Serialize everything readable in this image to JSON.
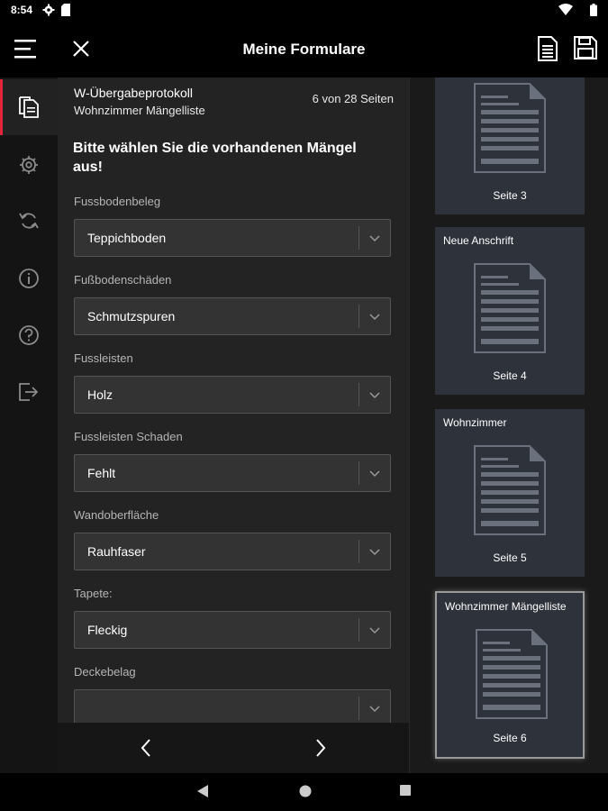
{
  "status_bar": {
    "time": "8:54"
  },
  "app_bar": {
    "title": "Meine Formulare"
  },
  "form": {
    "header_title": "W-Übergabeprotokoll",
    "header_subtitle": "Wohnzimmer Mängelliste",
    "page_indicator": "6 von 28 Seiten",
    "prompt": "Bitte wählen Sie die vorhandenen Mängel aus!",
    "fields": [
      {
        "label": "Fussbodenbeleg",
        "value": "Teppichboden"
      },
      {
        "label": "Fußbodenschäden",
        "value": "Schmutzspuren"
      },
      {
        "label": "Fussleisten",
        "value": "Holz"
      },
      {
        "label": "Fussleisten Schaden",
        "value": "Fehlt"
      },
      {
        "label": "Wandoberfläche",
        "value": "Rauhfaser"
      },
      {
        "label": "Tapete:",
        "value": "Fleckig"
      },
      {
        "label": "Deckebelag",
        "value": ""
      }
    ]
  },
  "thumbnails": [
    {
      "title": "",
      "page": "Seite 3"
    },
    {
      "title": "Neue Anschrift",
      "page": "Seite 4"
    },
    {
      "title": "Wohnzimmer",
      "page": "Seite 5"
    },
    {
      "title": "Wohnzimmer Mängelliste",
      "page": "Seite 6"
    }
  ],
  "colors": {
    "accent": "#e1263b",
    "card": "#2e323b",
    "panel": "#232323"
  }
}
